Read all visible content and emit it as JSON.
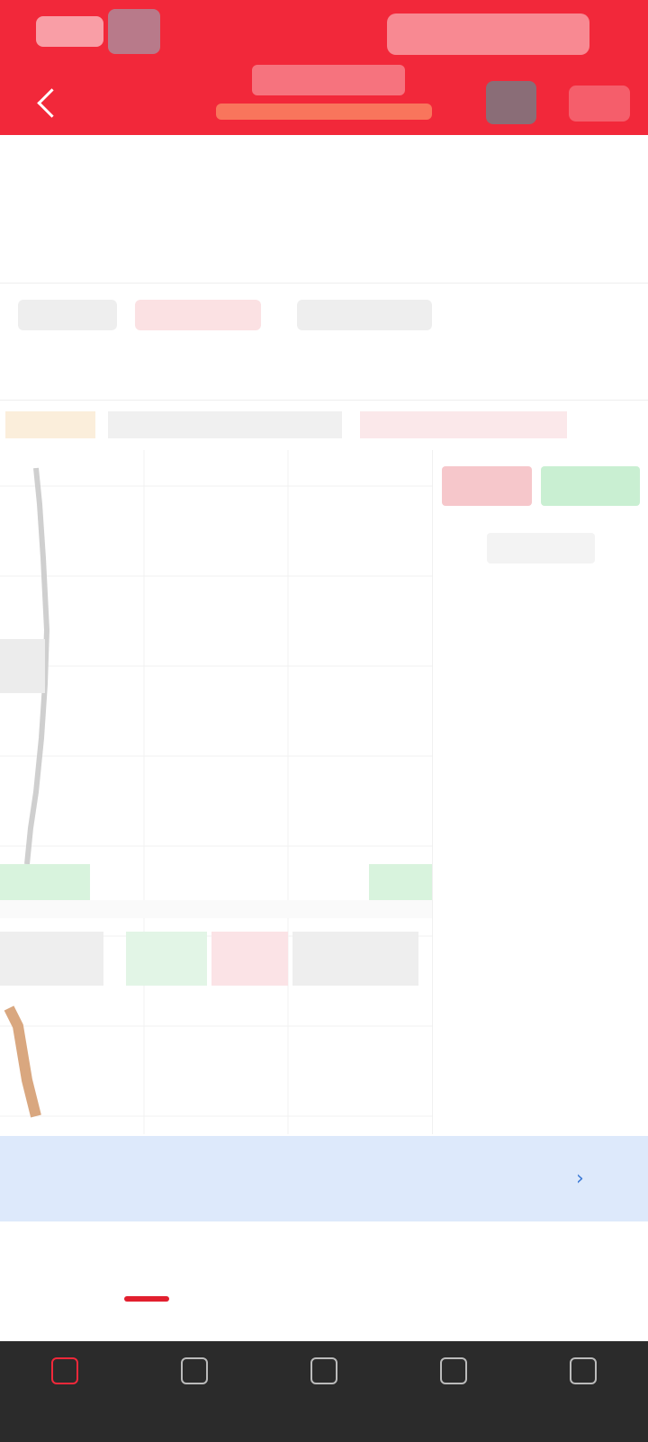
{
  "header": {
    "title": "",
    "subtitle": ""
  },
  "quote": {
    "price": "",
    "change": "",
    "metrics": [
      {
        "label": "",
        "value": ""
      },
      {
        "label": "",
        "value": ""
      },
      {
        "label": "",
        "value": ""
      }
    ]
  },
  "tags": [
    "",
    "",
    ""
  ],
  "period_tabs": [
    "",
    "",
    "",
    "",
    "",
    "",
    ""
  ],
  "indicators": [
    "",
    "",
    ""
  ],
  "order_book": {
    "title": "",
    "rows": [
      {
        "time": "",
        "price": "",
        "vol": ""
      },
      {
        "time": "",
        "price": "",
        "vol": ""
      },
      {
        "time": "",
        "price": "",
        "vol": ""
      },
      {
        "time": "",
        "price": "",
        "vol": ""
      },
      {
        "time": "",
        "price": "",
        "vol": ""
      },
      {
        "time": "",
        "price": "",
        "vol": ""
      },
      {
        "time": "",
        "price": "",
        "vol": ""
      },
      {
        "time": "",
        "price": "",
        "vol": ""
      },
      {
        "time": "",
        "price": "",
        "vol": ""
      },
      {
        "time": "",
        "price": "",
        "vol": ""
      },
      {
        "time": "",
        "price": "",
        "vol": ""
      },
      {
        "time": "",
        "price": "",
        "vol": ""
      }
    ]
  },
  "banner": {
    "text": "",
    "arrow": "›"
  },
  "section_tabs": [
    "",
    "",
    "",
    "",
    "",
    ""
  ],
  "bottom_nav": [
    "",
    "",
    "",
    "",
    ""
  ],
  "colors": {
    "brand": "#f2283a",
    "up": "#e21f2e",
    "down": "#1c9a39",
    "banner": "#dde9fb"
  }
}
